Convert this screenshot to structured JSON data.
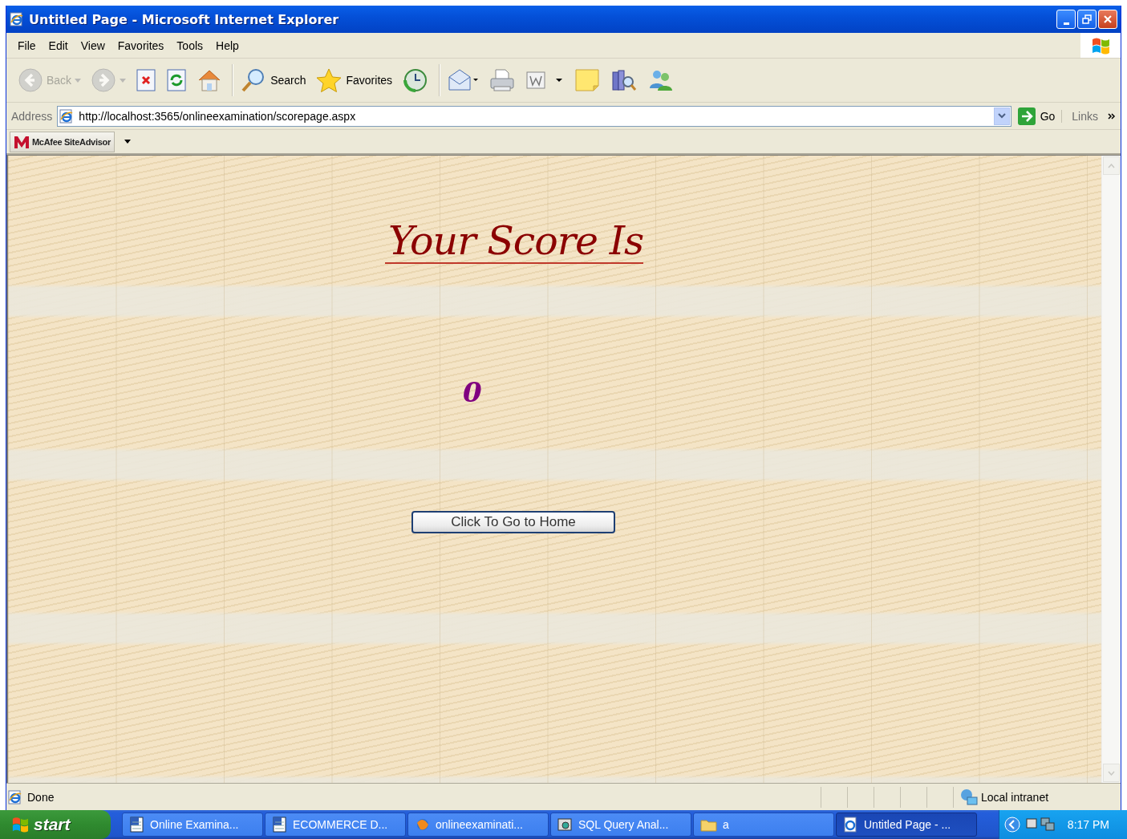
{
  "window": {
    "title": "Untitled Page - Microsoft Internet Explorer"
  },
  "menu": [
    "File",
    "Edit",
    "View",
    "Favorites",
    "Tools",
    "Help"
  ],
  "toolbar": [
    {
      "kind": "back",
      "label": "Back",
      "disabled": true
    },
    {
      "kind": "forward",
      "disabled": true
    },
    {
      "kind": "stop",
      "disabled": false
    },
    {
      "kind": "refresh",
      "disabled": false
    },
    {
      "kind": "home",
      "disabled": false
    },
    {
      "kind": "search",
      "label": "Search",
      "disabled": false
    },
    {
      "kind": "favorites",
      "label": "Favorites",
      "disabled": false
    },
    {
      "kind": "history",
      "disabled": false
    },
    {
      "kind": "mail",
      "disabled": false
    },
    {
      "kind": "print",
      "disabled": false
    },
    {
      "kind": "edit",
      "disabled": false
    },
    {
      "kind": "note",
      "disabled": false
    },
    {
      "kind": "research",
      "disabled": false
    },
    {
      "kind": "messenger",
      "disabled": false
    }
  ],
  "address": {
    "label": "Address",
    "url": "http://localhost:3565/onlineexamination/scorepage.aspx",
    "go": "Go",
    "links": "Links"
  },
  "addon_bar": {
    "label": "McAfee SiteAdvisor"
  },
  "page": {
    "heading": "Your Score Is",
    "score": "0",
    "button": "Click To Go to Home"
  },
  "status_bar": {
    "text": "Done",
    "zone": "Local intranet"
  },
  "taskbar": {
    "start": "start",
    "items": [
      {
        "kind": "document",
        "label": "Online Examina...",
        "selected": false
      },
      {
        "kind": "document",
        "label": "ECOMMERCE D...",
        "selected": false
      },
      {
        "kind": "app",
        "label": "onlineexaminati...",
        "selected": false
      },
      {
        "kind": "query",
        "label": "SQL Query Anal...",
        "selected": false
      },
      {
        "kind": "folder",
        "label": "a",
        "selected": false
      },
      {
        "kind": "browser",
        "label": "Untitled Page - ...",
        "selected": true
      }
    ],
    "clock": "8:17 PM"
  }
}
